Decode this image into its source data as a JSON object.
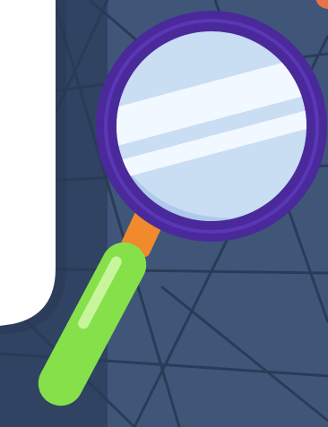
{
  "illustration": {
    "subject": "magnifying-glass",
    "colors": {
      "background_wall": "#3f5679",
      "background_dark": "#243550",
      "tile_lines": "#2a3b58",
      "paper": "#ffffff",
      "rim": "#4a2a9a",
      "rim_highlight": "#5c36b8",
      "lens": "#c9ddf3",
      "lens_shine": "#f2f8ff",
      "lens_shadow": "#a9c4e8",
      "neck": "#f08a2c",
      "handle": "#86e04a",
      "handle_highlight": "#c7f59b",
      "corner_accent": "#e8734a"
    }
  }
}
